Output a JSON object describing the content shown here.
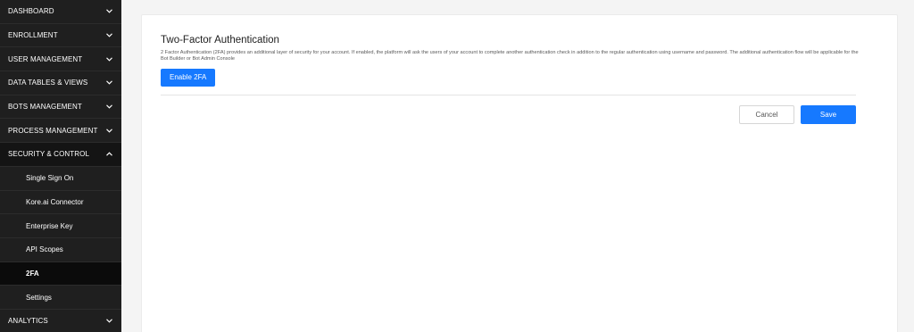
{
  "sidebar": {
    "items": [
      {
        "label": "DASHBOARD",
        "icon": "chevron-down-icon"
      },
      {
        "label": "ENROLLMENT",
        "icon": "chevron-down-icon"
      },
      {
        "label": "USER MANAGEMENT",
        "icon": "chevron-down-icon"
      },
      {
        "label": "DATA TABLES & VIEWS",
        "icon": "chevron-down-icon"
      },
      {
        "label": "BOTS MANAGEMENT",
        "icon": "chevron-down-icon"
      },
      {
        "label": "PROCESS MANAGEMENT",
        "icon": "chevron-down-icon"
      },
      {
        "label": "SECURITY & CONTROL",
        "icon": "chevron-up-icon"
      },
      {
        "label": "ANALYTICS",
        "icon": "chevron-down-icon"
      }
    ],
    "sub_items": [
      {
        "label": "Single Sign On"
      },
      {
        "label": "Kore.ai Connector"
      },
      {
        "label": "Enterprise Key"
      },
      {
        "label": "API Scopes"
      },
      {
        "label": "2FA"
      },
      {
        "label": "Settings"
      }
    ]
  },
  "main": {
    "title": "Two-Factor Authentication",
    "description": "2 Factor Authentication (2FA) provides an additional layer of security for your account. If enabled, the platform will ask the users of your account to complete another authentication check in addition to the regular authentication using username and password. The additional authentication flow will be applicable for the Bot Builder or Bot Admin Console",
    "enable_label": "Enable 2FA",
    "cancel_label": "Cancel",
    "save_label": "Save"
  },
  "colors": {
    "sidebar_bg": "#1f1f1f",
    "active_bg": "#0b0b0b",
    "primary": "#1679ff"
  }
}
